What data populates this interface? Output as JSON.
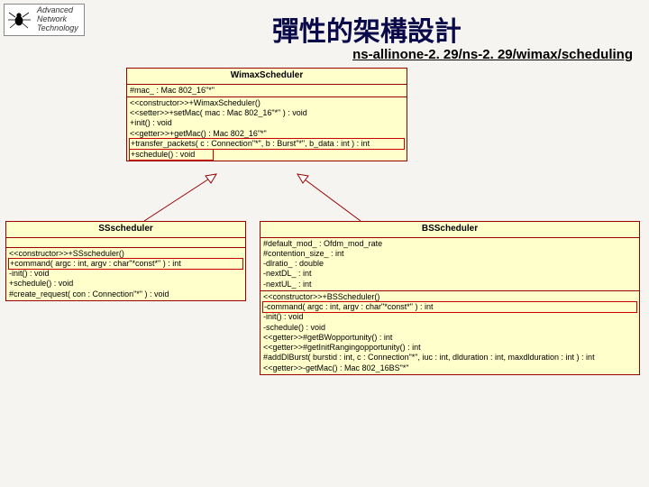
{
  "header": {
    "logo_line1": "Advanced",
    "logo_line2": "Network",
    "logo_line3": "Technology",
    "title": "彈性的架構設計",
    "subtitle": "ns-allinone-2. 29/ns-2. 29/wimax/scheduling"
  },
  "classes": {
    "wimax": {
      "name": "WimaxScheduler",
      "attrs": [
        "#mac_ : Mac 802_16\"*\""
      ],
      "ops": [
        "<<constructor>>+WimaxScheduler()",
        "<<setter>>+setMac( mac : Mac 802_16\"*\" ) : void",
        "+init() : void",
        "<<getter>>+getMac() : Mac 802_16\"*\"",
        "+transfer_packets( c : Connection\"*\", b : Burst\"*\", b_data : int ) : int",
        "+schedule() : void"
      ]
    },
    "ss": {
      "name": "SSscheduler",
      "ops": [
        "<<constructor>>+SSscheduler()",
        "+command( argc : int, argv : char\"*const*\" ) : int",
        "-init() : void",
        "+schedule() : void",
        "#create_request( con : Connection\"*\" ) : void"
      ]
    },
    "bs": {
      "name": "BSScheduler",
      "attrs": [
        "#default_mod_ : Ofdm_mod_rate",
        "#contention_size_ : int",
        "-dlratio_ : double",
        "-nextDL_ : int",
        "-nextUL_ : int"
      ],
      "ops": [
        "<<constructor>>+BSScheduler()",
        "-command( argc : int, argv : char\"*const*\" ) : int",
        "-init() : void",
        "-schedule() : void",
        "<<getter>>#getBWopportunity() : int",
        "<<getter>>#getInitRangingopportunity() : int",
        "#addDlBurst( burstid : int, c : Connection\"*\", iuc : int, dlduration : int, maxdlduration : int ) : int",
        "<<getter>>-getMac() : Mac 802_16BS\"*\""
      ]
    }
  }
}
